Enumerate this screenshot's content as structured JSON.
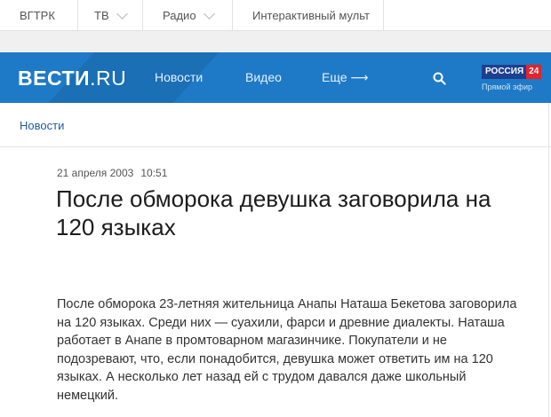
{
  "topbar": {
    "items": [
      {
        "label": "ВГТРК"
      },
      {
        "label": "ТВ"
      },
      {
        "label": "Радио"
      },
      {
        "label": "Интерактивный мульт"
      }
    ]
  },
  "header": {
    "logo_main": "ВЕСТИ",
    "logo_suffix": ".RU",
    "nav": {
      "news": "Новости",
      "video": "Видео",
      "more": "Еще ⟶"
    },
    "channel": {
      "name": "РОССИЯ",
      "number": "24",
      "live": "Прямой эфир"
    },
    "colors": {
      "bar": "#1e7ac6",
      "channel_blue": "#1c3f8f",
      "channel_red": "#e3242b"
    }
  },
  "breadcrumb": {
    "label": "Новости"
  },
  "article": {
    "date": "21 апреля 2003",
    "time": "10:51",
    "title": "После обморока девушка заговорила на 120 языках",
    "body": "После обморока 23-летняя жительница Анапы Наташа Бекетова заговорила на 120 языках. Среди них — суахили, фарси и древние диалекты. Наташа работает в Анапе в промтоварном магазинчике. Покупатели и не подозревают, что, если понадобится, девушка может ответить им на 120 языках. А несколько лет назад ей с трудом давался даже школьный немецкий."
  }
}
